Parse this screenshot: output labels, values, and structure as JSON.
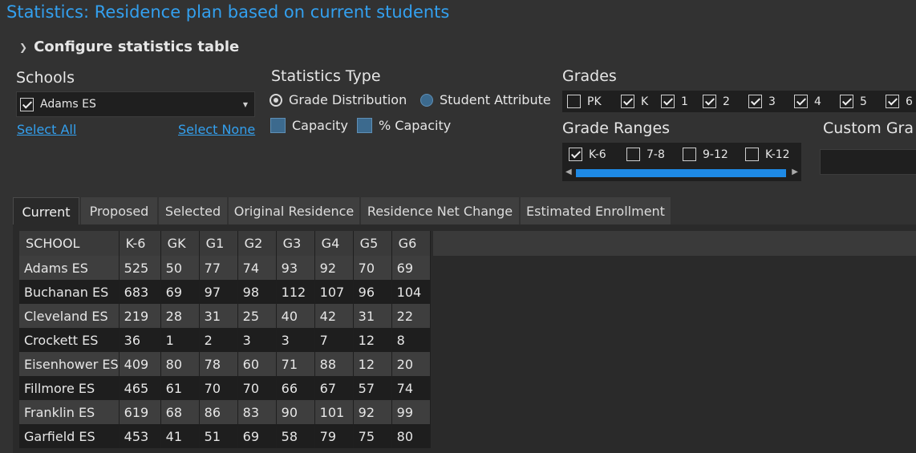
{
  "title": "Statistics: Residence plan based on current students",
  "config": {
    "label": "Configure statistics table"
  },
  "schools": {
    "heading": "Schools",
    "selected": "Adams ES",
    "select_all": "Select All",
    "select_none": "Select None"
  },
  "stats_type": {
    "heading": "Statistics Type",
    "options": [
      {
        "label": "Grade Distribution",
        "selected": true
      },
      {
        "label": "Student Attribute",
        "selected": false
      }
    ],
    "checks": [
      {
        "label": "Capacity",
        "checked": false
      },
      {
        "label": "% Capacity",
        "checked": false
      }
    ]
  },
  "grades": {
    "heading": "Grades",
    "items": [
      {
        "label": "PK",
        "checked": false
      },
      {
        "label": "K",
        "checked": true
      },
      {
        "label": "1",
        "checked": true
      },
      {
        "label": "2",
        "checked": true
      },
      {
        "label": "3",
        "checked": true
      },
      {
        "label": "4",
        "checked": true
      },
      {
        "label": "5",
        "checked": true
      },
      {
        "label": "6",
        "checked": true
      }
    ]
  },
  "grade_ranges": {
    "heading": "Grade Ranges",
    "items": [
      {
        "label": "K-6",
        "checked": true
      },
      {
        "label": "7-8",
        "checked": false
      },
      {
        "label": "9-12",
        "checked": false
      },
      {
        "label": "K-12",
        "checked": false
      }
    ]
  },
  "custom": {
    "heading": "Custom Gra"
  },
  "tabs": [
    {
      "label": "Current",
      "active": true
    },
    {
      "label": "Proposed",
      "active": false
    },
    {
      "label": "Selected",
      "active": false
    },
    {
      "label": "Original Residence",
      "active": false
    },
    {
      "label": "Residence Net Change",
      "active": false
    },
    {
      "label": "Estimated Enrollment",
      "active": false
    }
  ],
  "table": {
    "columns": [
      "SCHOOL",
      "K-6",
      "GK",
      "G1",
      "G2",
      "G3",
      "G4",
      "G5",
      "G6"
    ],
    "rows": [
      [
        "Adams ES",
        "525",
        "50",
        "77",
        "74",
        "93",
        "92",
        "70",
        "69"
      ],
      [
        "Buchanan ES",
        "683",
        "69",
        "97",
        "98",
        "112",
        "107",
        "96",
        "104"
      ],
      [
        "Cleveland ES",
        "219",
        "28",
        "31",
        "25",
        "40",
        "42",
        "31",
        "22"
      ],
      [
        "Crockett ES",
        "36",
        "1",
        "2",
        "3",
        "3",
        "7",
        "12",
        "8"
      ],
      [
        "Eisenhower ES",
        "409",
        "80",
        "78",
        "60",
        "71",
        "88",
        "12",
        "20"
      ],
      [
        "Fillmore ES",
        "465",
        "61",
        "70",
        "70",
        "66",
        "67",
        "57",
        "74"
      ],
      [
        "Franklin ES",
        "619",
        "68",
        "86",
        "83",
        "90",
        "101",
        "92",
        "99"
      ],
      [
        "Garfield ES",
        "453",
        "41",
        "51",
        "69",
        "58",
        "79",
        "75",
        "80"
      ]
    ]
  }
}
